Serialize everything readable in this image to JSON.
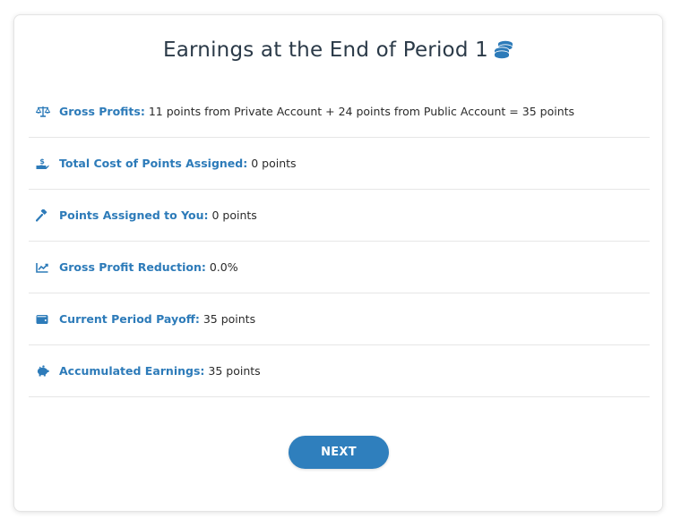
{
  "page": {
    "title": "Earnings at the End of Period 1",
    "title_icon": "coins-icon",
    "accent_color": "#2d7bb9"
  },
  "rows": [
    {
      "icon": "balance-scale-icon",
      "label": "Gross Profits:",
      "value": "11 points from Private Account + 24 points from Public Account = 35 points"
    },
    {
      "icon": "hand-holding-dollar-icon",
      "label": "Total Cost of Points Assigned:",
      "value": "0 points"
    },
    {
      "icon": "gavel-icon",
      "label": "Points Assigned to You:",
      "value": "0 points"
    },
    {
      "icon": "chart-line-icon",
      "label": "Gross Profit Reduction:",
      "value": "0.0%"
    },
    {
      "icon": "wallet-icon",
      "label": "Current Period Payoff:",
      "value": "35 points"
    },
    {
      "icon": "piggy-bank-icon",
      "label": "Accumulated Earnings:",
      "value": "35 points"
    }
  ],
  "actions": {
    "next_label": "NEXT"
  }
}
